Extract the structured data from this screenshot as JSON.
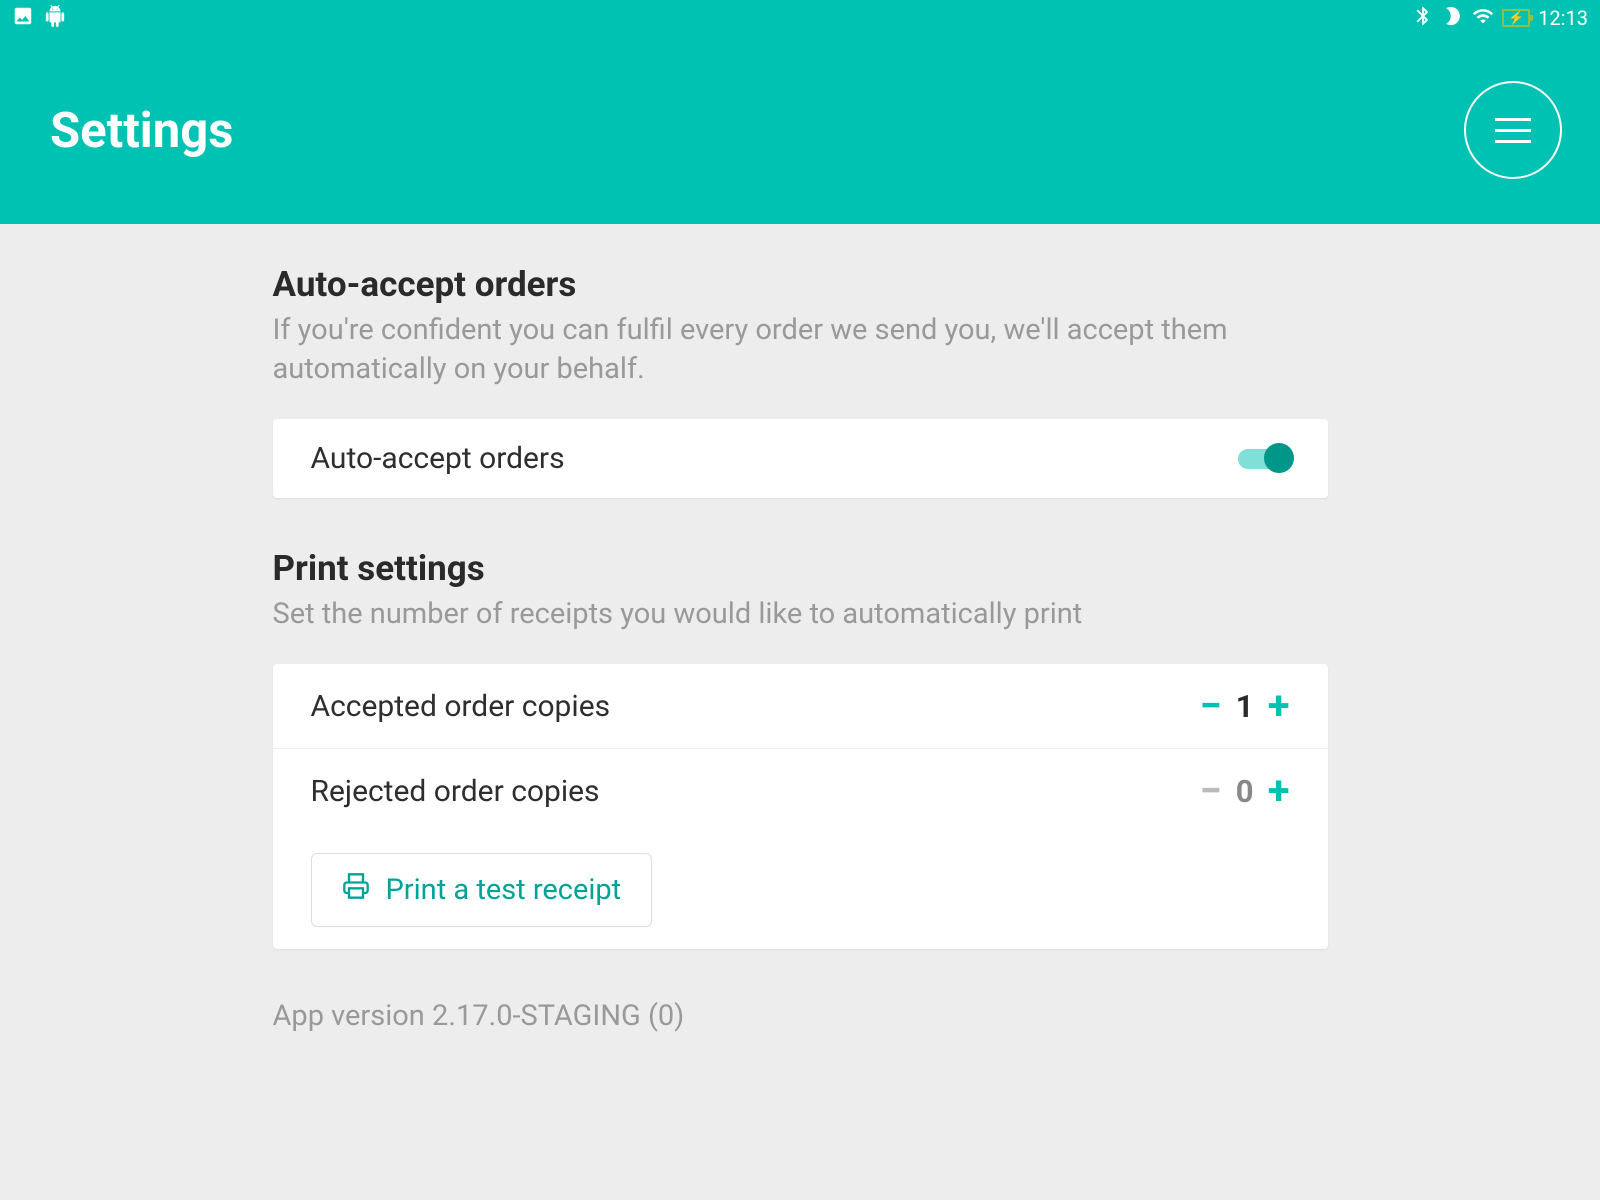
{
  "status_bar": {
    "time": "12:13"
  },
  "header": {
    "title": "Settings"
  },
  "sections": {
    "auto_accept": {
      "title": "Auto-accept orders",
      "description": "If you're confident you can fulfil every order we send you, we'll accept them automatically on your behalf.",
      "toggle_label": "Auto-accept orders",
      "toggle_state": true
    },
    "print": {
      "title": "Print settings",
      "description": "Set the number of receipts you would like to automatically print",
      "rows": {
        "accepted": {
          "label": "Accepted order copies",
          "value": "1"
        },
        "rejected": {
          "label": "Rejected order copies",
          "value": "0"
        }
      },
      "test_button": "Print a test receipt"
    }
  },
  "footer": {
    "app_version": "App version 2.17.0-STAGING (0)"
  },
  "colors": {
    "accent": "#00c2b3",
    "accent_dark": "#009688"
  }
}
